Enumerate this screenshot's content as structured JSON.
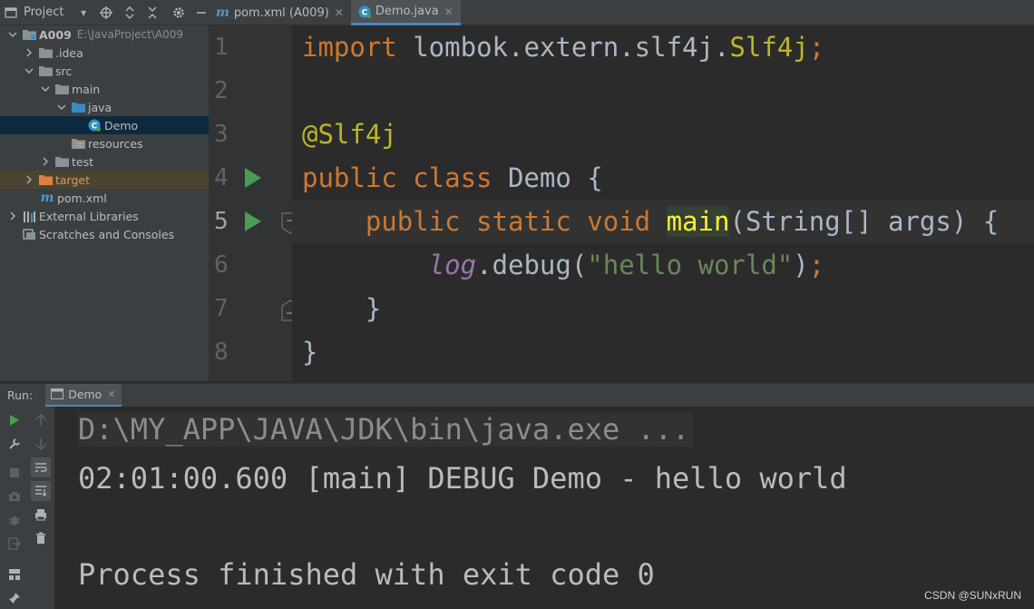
{
  "project_panel": {
    "title": "Project",
    "tree": [
      {
        "label": "A009",
        "path": "E:\\JavaProject\\A009"
      },
      {
        "label": ".idea"
      },
      {
        "label": "src"
      },
      {
        "label": "main"
      },
      {
        "label": "java"
      },
      {
        "label": "Demo"
      },
      {
        "label": "resources"
      },
      {
        "label": "test"
      },
      {
        "label": "target"
      },
      {
        "label": "pom.xml"
      },
      {
        "label": "External Libraries"
      },
      {
        "label": "Scratches and Consoles"
      }
    ]
  },
  "editor_tabs": [
    {
      "label": "pom.xml (A009)",
      "active": false
    },
    {
      "label": "Demo.java",
      "active": true
    }
  ],
  "editor": {
    "line_numbers": [
      "1",
      "2",
      "3",
      "4",
      "5",
      "6",
      "7",
      "8"
    ],
    "code": {
      "l1_kw": "import",
      "l1_rest": " lombok.extern.slf4j.",
      "l1_cls": "Slf4j",
      "l1_semi": ";",
      "l3_ann": "@Slf4j",
      "l4_kw": "public class",
      "l4_rest": " Demo {",
      "l5_kw": "    public static void",
      "l5_sp": " ",
      "l5_name": "main",
      "l5_rest": "(String[] args) {",
      "l6_indent": "        ",
      "l6_log": "log",
      "l6_call": ".debug(",
      "l6_str": "\"hello world\"",
      "l6_end": ")",
      "l6_semi": ";",
      "l7": "    }",
      "l8": "}"
    }
  },
  "run_window": {
    "label": "Run:",
    "tab": "Demo",
    "console": [
      "D:\\MY_APP\\JAVA\\JDK\\bin\\java.exe ...",
      "02:01:00.600 [main] DEBUG Demo - hello world",
      "",
      "Process finished with exit code 0"
    ]
  },
  "watermark": "CSDN @SUNxRUN",
  "colors": {
    "keyword": "#cc7832",
    "annotation": "#bbb529",
    "string": "#6a8759",
    "run_green": "#499c54",
    "accent": "#4a88c7"
  }
}
